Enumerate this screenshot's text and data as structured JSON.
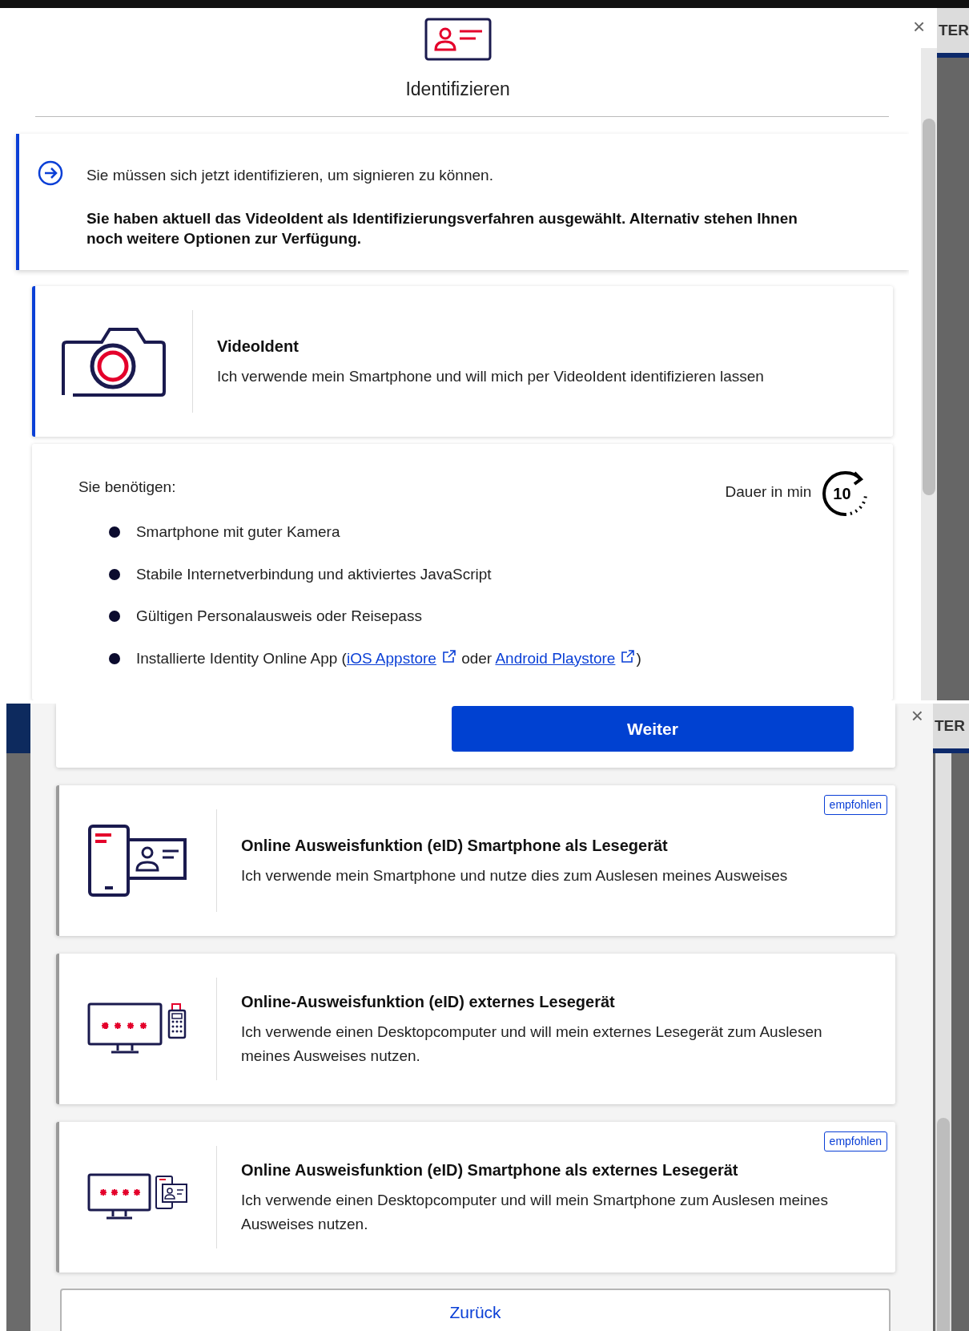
{
  "upper_view": {
    "close": "×",
    "background_text": "TER",
    "header": {
      "title": "Identifizieren"
    },
    "info": {
      "lead": "Sie müssen sich jetzt identifizieren, um signieren zu können.",
      "note": "Sie haben aktuell das VideoIdent als Identifizierungsverfahren ausgewählt. Alternativ stehen Ihnen noch weitere Optionen zur Verfügung."
    },
    "method": {
      "kind": "camera",
      "title": "VideoIdent",
      "description": "Ich verwende mein Smartphone und will mich per VideoIdent identifizieren lassen",
      "selected": true
    },
    "requirements": {
      "heading": "Sie benötigen:",
      "duration_label": "Dauer in min",
      "duration": "10",
      "items": [
        {
          "parts": [
            {
              "kind": "text",
              "text": "Smartphone mit guter Kamera"
            }
          ]
        },
        {
          "parts": [
            {
              "kind": "text",
              "text": "Stabile Internetverbindung und aktiviertes JavaScript"
            }
          ]
        },
        {
          "parts": [
            {
              "kind": "text",
              "text": "Gültigen Personalausweis oder Reisepass"
            }
          ]
        },
        {
          "parts": [
            {
              "kind": "text",
              "text": "Installierte Identity Online App ("
            },
            {
              "kind": "link",
              "text": "iOS Appstore"
            },
            {
              "kind": "text",
              "text": " oder "
            },
            {
              "kind": "link",
              "text": "Android Playstore"
            },
            {
              "kind": "text",
              "text": ")"
            }
          ]
        }
      ]
    }
  },
  "lower_view": {
    "close": "×",
    "background_text": "TER",
    "continue_button": "Weiter",
    "methods": [
      {
        "kind": "phone-card",
        "title": "Online Ausweisfunktion (eID) Smartphone als Lesegerät",
        "description": "Ich verwende mein Smartphone und nutze dies zum Auslesen meines Ausweises",
        "badge": "empfohlen",
        "selected": false
      },
      {
        "kind": "desktop-reader",
        "title": "Online-Ausweisfunktion (eID) externes Lesegerät",
        "description": "Ich verwende einen Desktopcomputer und will mein externes Lesegerät zum Auslesen meines Ausweises nutzen.",
        "selected": false
      },
      {
        "kind": "desktop-phone",
        "title": "Online Ausweisfunktion (eID) Smartphone als externes Lesegerät",
        "description": "Ich verwende einen Desktopcomputer und will mein Smartphone zum Auslesen meines Ausweises nutzen.",
        "badge": "empfohlen",
        "selected": false
      }
    ],
    "back_button": "Zurück"
  }
}
